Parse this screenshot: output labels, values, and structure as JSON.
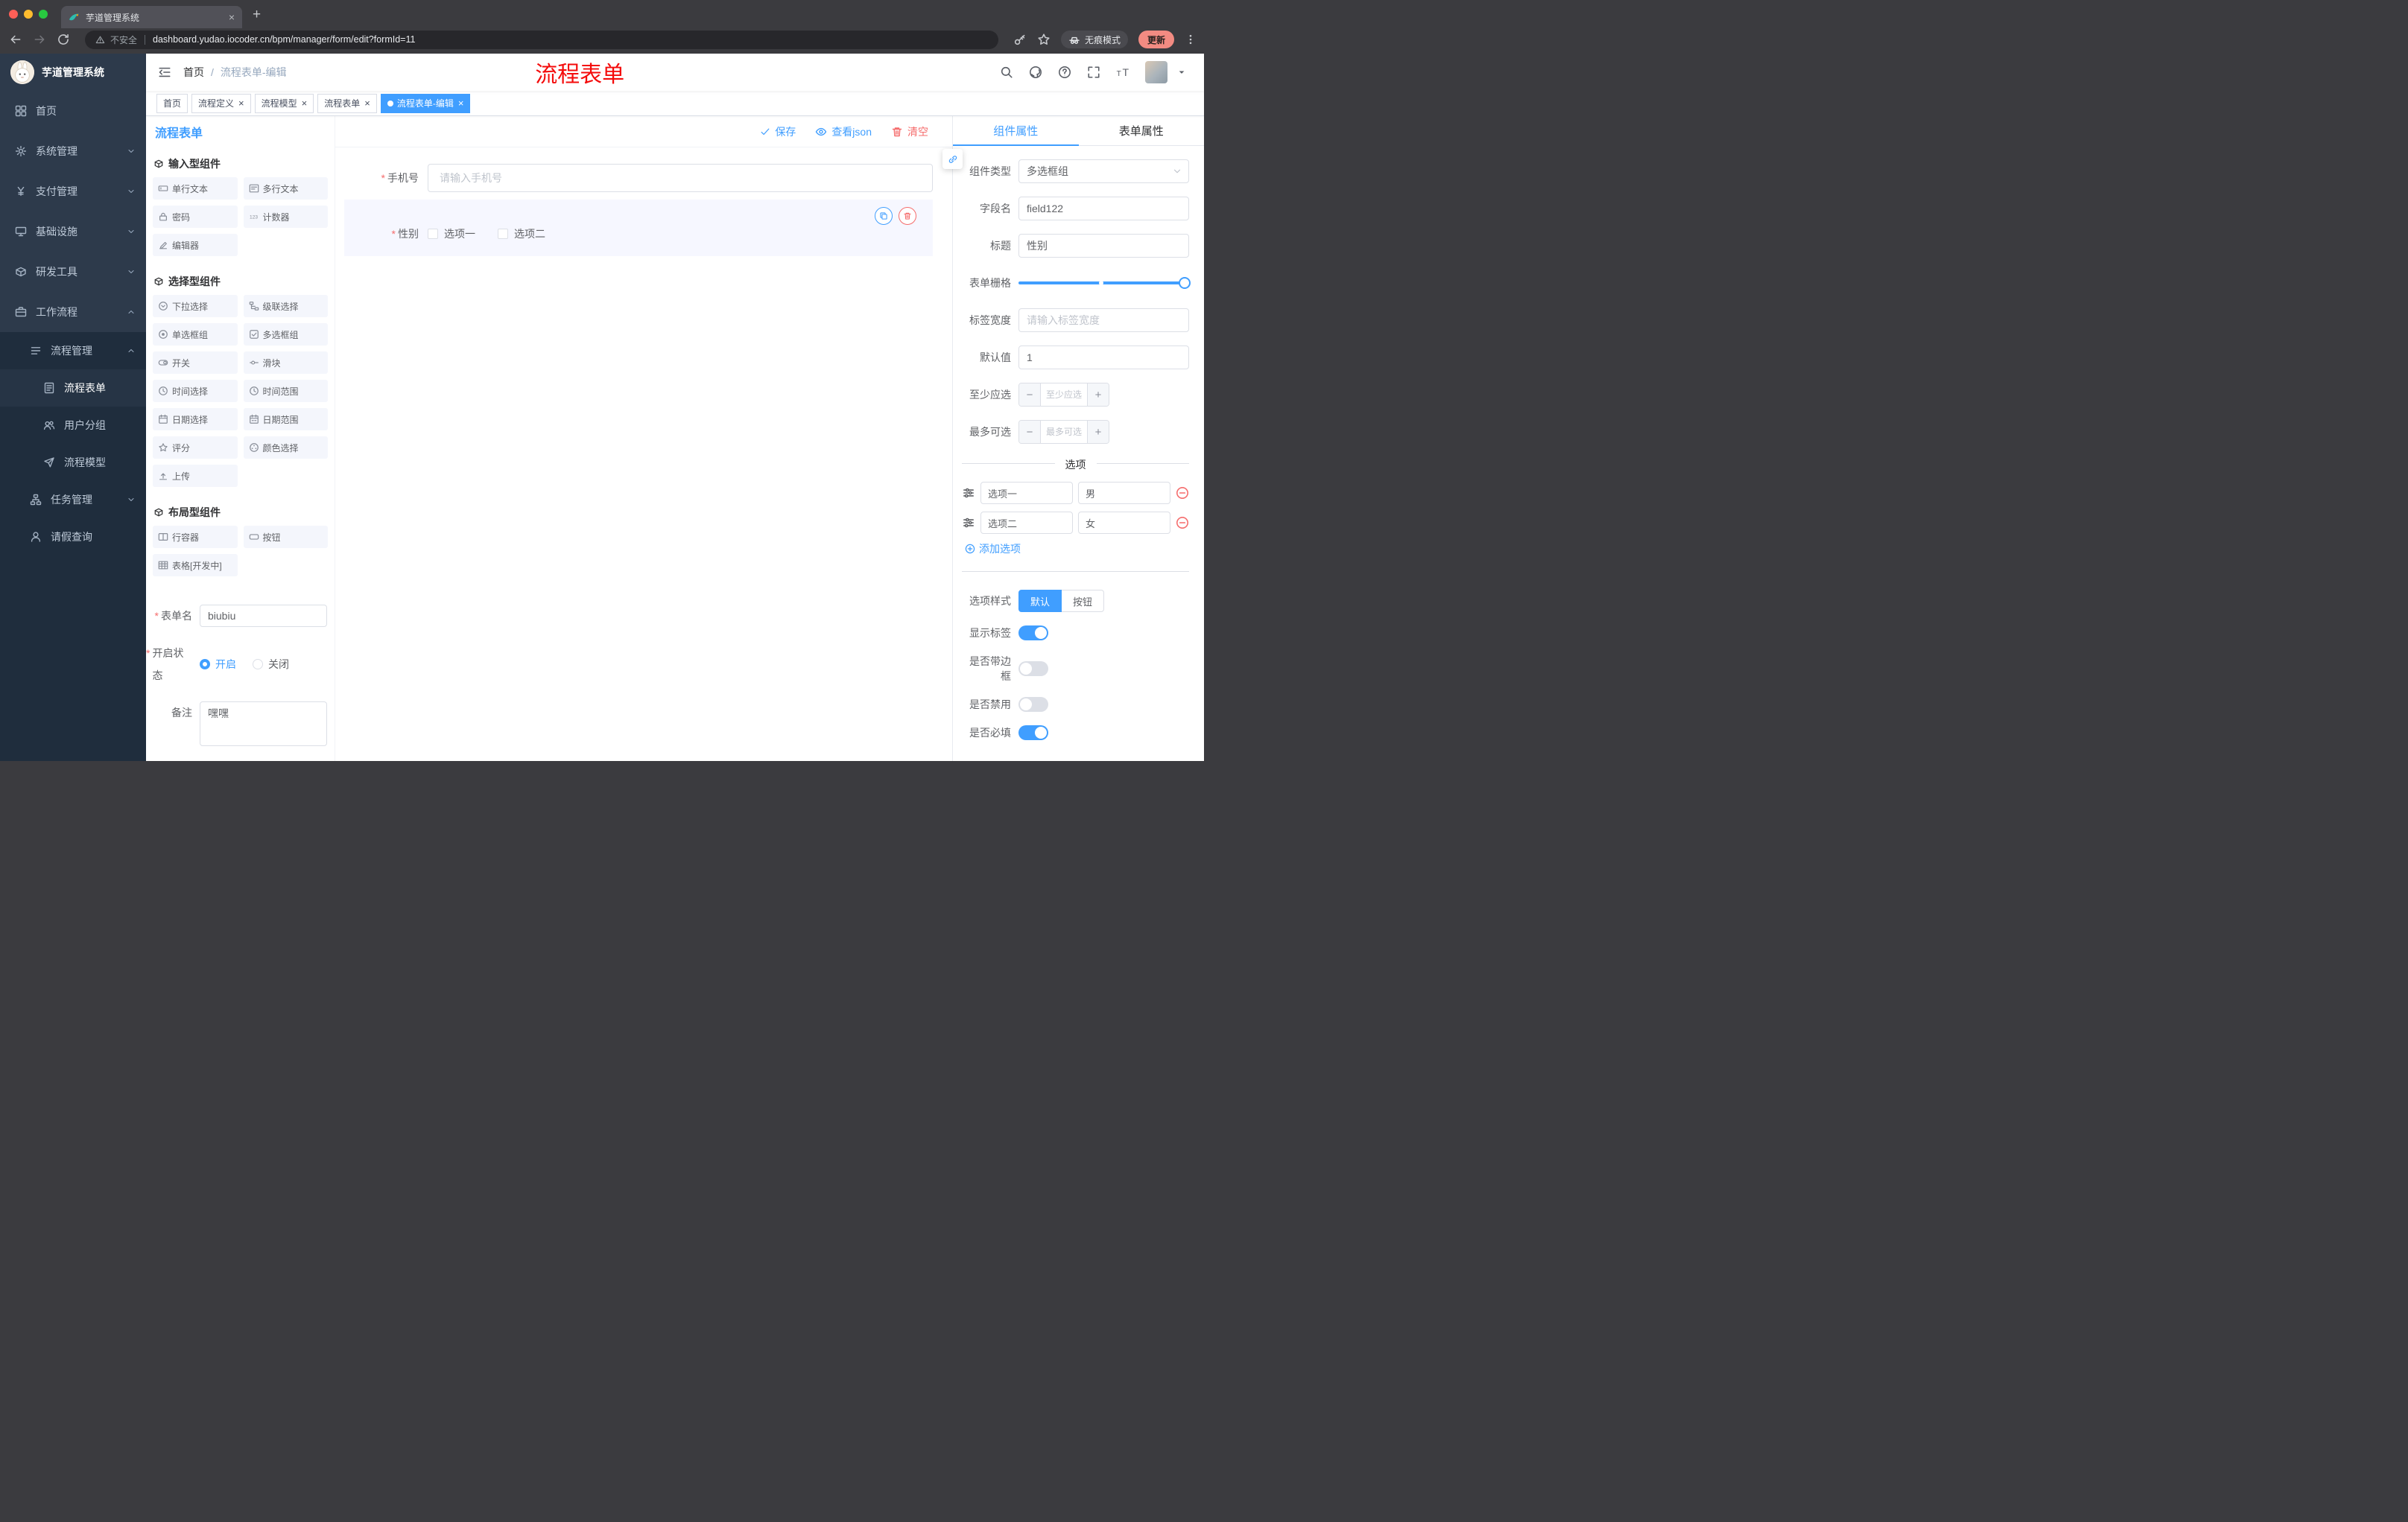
{
  "theme": {
    "primary": "#409EFF",
    "danger": "#F56C6C",
    "annotation_red": "#F40B0B",
    "sidebar_bg": "#2D3A4B",
    "sidebar_sub_bg": "#1F2D3D"
  },
  "browser": {
    "tab": {
      "title": "芋道管理系统"
    },
    "address": {
      "security": "不安全",
      "url": "dashboard.yudao.iocoder.cn/bpm/manager/form/edit?formId=11"
    },
    "incognito": "无痕模式",
    "update": "更新"
  },
  "sidebar": {
    "logo": "芋道管理系统",
    "items": [
      {
        "label": "首页",
        "icon": "dashboard-icon",
        "level": 0,
        "expandable": false,
        "active": false
      },
      {
        "label": "系统管理",
        "icon": "gear-icon",
        "level": 0,
        "expandable": true,
        "expanded": false,
        "active": false
      },
      {
        "label": "支付管理",
        "icon": "payment-icon",
        "level": 0,
        "expandable": true,
        "expanded": false,
        "active": false
      },
      {
        "label": "基础设施",
        "icon": "infrastructure-icon",
        "level": 0,
        "expandable": true,
        "expanded": false,
        "active": false
      },
      {
        "label": "研发工具",
        "icon": "devtools-icon",
        "level": 0,
        "expandable": true,
        "expanded": false,
        "active": false
      },
      {
        "label": "工作流程",
        "icon": "workflow-icon",
        "level": 0,
        "expandable": true,
        "expanded": true,
        "active": false
      },
      {
        "label": "流程管理",
        "icon": "process-manage-icon",
        "level": 1,
        "expandable": true,
        "expanded": true,
        "active": false
      },
      {
        "label": "流程表单",
        "icon": "process-form-icon",
        "level": 2,
        "expandable": false,
        "active": true
      },
      {
        "label": "用户分组",
        "icon": "user-group-icon",
        "level": 2,
        "expandable": false,
        "active": false
      },
      {
        "label": "流程模型",
        "icon": "process-model-icon",
        "level": 2,
        "expandable": false,
        "active": false
      },
      {
        "label": "任务管理",
        "icon": "task-manage-icon",
        "level": 1,
        "expandable": true,
        "expanded": false,
        "active": false
      },
      {
        "label": "请假查询",
        "icon": "leave-query-icon",
        "level": 1,
        "expandable": false,
        "active": false
      }
    ]
  },
  "header": {
    "breadcrumb": [
      "首页",
      "流程表单-编辑"
    ],
    "annotation": "流程表单"
  },
  "tags": [
    {
      "label": "首页",
      "closable": false,
      "active": false
    },
    {
      "label": "流程定义",
      "closable": true,
      "active": false
    },
    {
      "label": "流程模型",
      "closable": true,
      "active": false
    },
    {
      "label": "流程表单",
      "closable": true,
      "active": false
    },
    {
      "label": "流程表单-编辑",
      "closable": true,
      "active": true
    }
  ],
  "library": {
    "title": "流程表单",
    "groups": [
      {
        "title": "输入型组件",
        "icon": "group-icon",
        "items": [
          {
            "label": "单行文本",
            "icon": "input-icon"
          },
          {
            "label": "多行文本",
            "icon": "textarea-icon"
          },
          {
            "label": "密码",
            "icon": "password-icon"
          },
          {
            "label": "计数器",
            "icon": "counter-icon"
          },
          {
            "label": "编辑器",
            "icon": "editor-icon"
          }
        ]
      },
      {
        "title": "选择型组件",
        "icon": "group-icon",
        "items": [
          {
            "label": "下拉选择",
            "icon": "select-icon"
          },
          {
            "label": "级联选择",
            "icon": "cascade-icon"
          },
          {
            "label": "单选框组",
            "icon": "radio-icon"
          },
          {
            "label": "多选框组",
            "icon": "checkbox-icon"
          },
          {
            "label": "开关",
            "icon": "switch-icon"
          },
          {
            "label": "滑块",
            "icon": "slider-icon"
          },
          {
            "label": "时间选择",
            "icon": "time-icon"
          },
          {
            "label": "时间范围",
            "icon": "time-range-icon"
          },
          {
            "label": "日期选择",
            "icon": "date-icon"
          },
          {
            "label": "日期范围",
            "icon": "date-range-icon"
          },
          {
            "label": "评分",
            "icon": "rate-icon"
          },
          {
            "label": "颜色选择",
            "icon": "color-icon"
          },
          {
            "label": "上传",
            "icon": "upload-icon"
          }
        ]
      },
      {
        "title": "布局型组件",
        "icon": "group-icon",
        "items": [
          {
            "label": "行容器",
            "icon": "row-icon"
          },
          {
            "label": "按钮",
            "icon": "button-icon"
          },
          {
            "label": "表格[开发中]",
            "icon": "table-icon"
          }
        ]
      }
    ],
    "meta": {
      "name": {
        "label": "表单名",
        "required": true,
        "value": "biubiu"
      },
      "status": {
        "label": "开启状态",
        "required": true,
        "options": [
          "开启",
          "关闭"
        ],
        "selected": "开启"
      },
      "remark": {
        "label": "备注",
        "value": "嘿嘿"
      }
    }
  },
  "toolbar": {
    "save": "保存",
    "view_json": "查看json",
    "clear": "清空"
  },
  "canvas": {
    "fields": [
      {
        "type": "input",
        "label": "手机号",
        "required": true,
        "placeholder": "请输入手机号"
      },
      {
        "type": "checkbox-group",
        "label": "性别",
        "required": true,
        "selected": true,
        "options": [
          {
            "label": "选项一",
            "checked": false
          },
          {
            "label": "选项二",
            "checked": false
          }
        ]
      }
    ]
  },
  "properties": {
    "tabs": [
      {
        "label": "组件属性",
        "active": true
      },
      {
        "label": "表单属性",
        "active": false
      }
    ],
    "rows": [
      {
        "label": "组件类型",
        "type": "select",
        "value": "多选框组"
      },
      {
        "label": "字段名",
        "type": "input",
        "value": "field122"
      },
      {
        "label": "标题",
        "type": "input",
        "value": "性别"
      },
      {
        "label": "表单栅格",
        "type": "slider",
        "value": "max"
      },
      {
        "label": "标签宽度",
        "type": "input",
        "placeholder": "请输入标签宽度"
      },
      {
        "label": "默认值",
        "type": "input",
        "value": "1"
      },
      {
        "label": "至少应选",
        "type": "stepper",
        "placeholder": "至少应选"
      },
      {
        "label": "最多可选",
        "type": "stepper",
        "placeholder": "最多可选"
      }
    ],
    "options_section": {
      "divider": "选项",
      "options": [
        {
          "label": "选项一",
          "value": "男"
        },
        {
          "label": "选项二",
          "value": "女"
        }
      ],
      "add_label": "添加选项"
    },
    "style_row": {
      "label": "选项样式",
      "options": [
        "默认",
        "按钮"
      ],
      "selected": "默认"
    },
    "switch_rows": [
      {
        "label": "显示标签",
        "on": true
      },
      {
        "label": "是否带边框",
        "on": false
      },
      {
        "label": "是否禁用",
        "on": false
      },
      {
        "label": "是否必填",
        "on": true
      }
    ]
  }
}
